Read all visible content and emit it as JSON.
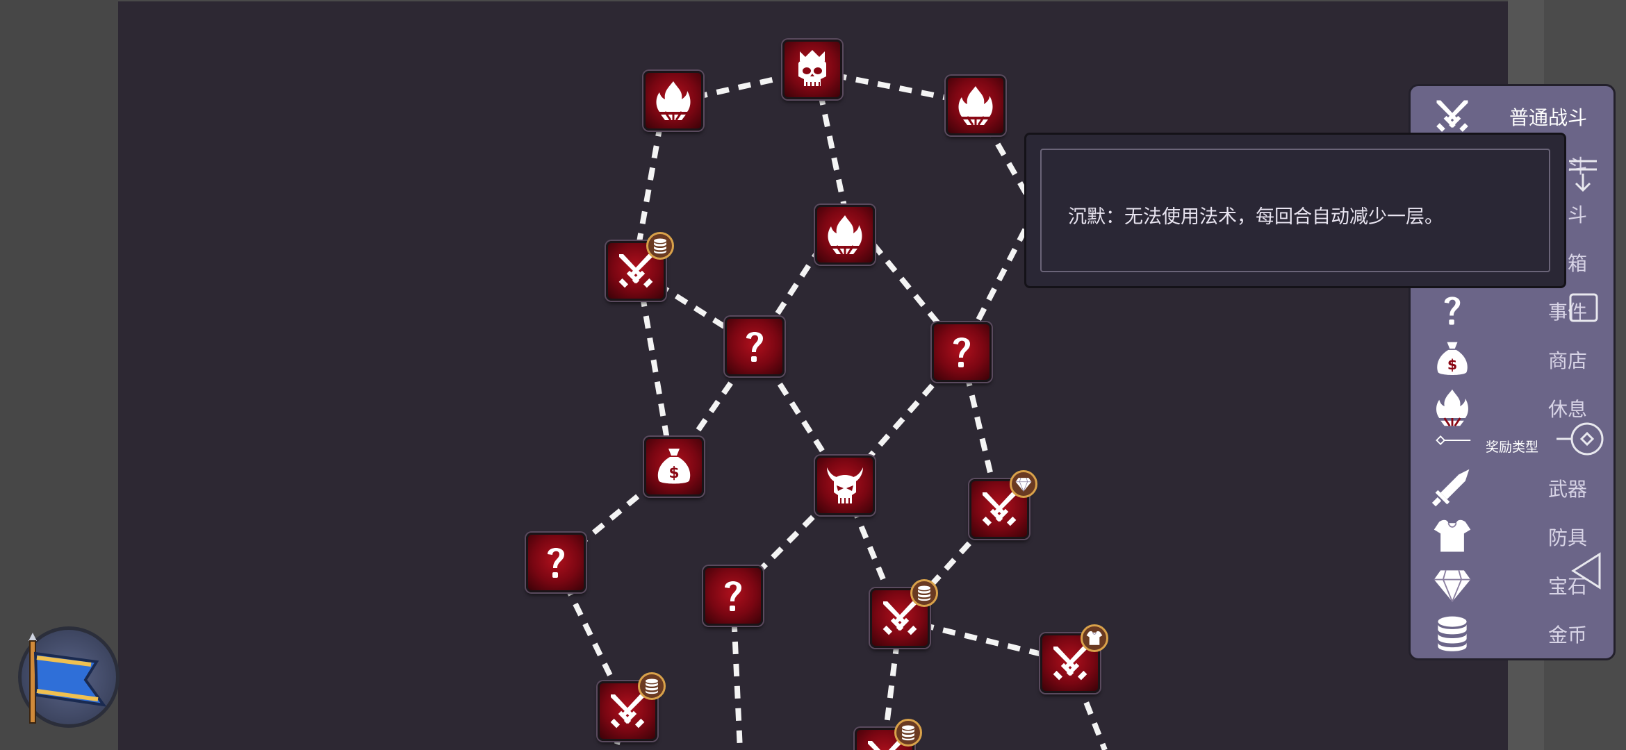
{
  "tooltip": {
    "text": "沉默：无法使用法术，每回合自动减少一层。"
  },
  "legend": {
    "items": [
      {
        "label": "普通战斗",
        "icon": "crossed-swords-icon"
      },
      {
        "label": "斗",
        "icon": "hidden"
      },
      {
        "label": "斗",
        "icon": "hidden"
      },
      {
        "label": "箱",
        "icon": "hidden"
      },
      {
        "label": "事件",
        "icon": "question-icon"
      },
      {
        "label": "商店",
        "icon": "money-bag-icon"
      },
      {
        "label": "休息",
        "icon": "campfire-icon"
      },
      {
        "label": "奖励类型",
        "icon": "divider-icon"
      },
      {
        "label": "武器",
        "icon": "sword-icon"
      },
      {
        "label": "防具",
        "icon": "armor-icon"
      },
      {
        "label": "宝石",
        "icon": "gem-icon"
      },
      {
        "label": "金币",
        "icon": "coins-icon"
      }
    ]
  },
  "map": {
    "nodes": [
      {
        "type": "elite-boss",
        "icon": "crowned-skull-icon"
      },
      {
        "type": "rest",
        "icon": "campfire-icon"
      },
      {
        "type": "rest",
        "icon": "campfire-icon"
      },
      {
        "type": "rest",
        "icon": "campfire-icon"
      },
      {
        "type": "battle",
        "icon": "crossed-swords-icon",
        "reward": "coins-icon"
      },
      {
        "type": "event",
        "icon": "question-icon"
      },
      {
        "type": "event",
        "icon": "question-icon"
      },
      {
        "type": "shop",
        "icon": "money-bag-icon"
      },
      {
        "type": "elite",
        "icon": "horned-skull-icon"
      },
      {
        "type": "battle",
        "icon": "crossed-swords-icon",
        "reward": "gem-icon"
      },
      {
        "type": "event",
        "icon": "question-icon"
      },
      {
        "type": "event",
        "icon": "question-icon"
      },
      {
        "type": "battle",
        "icon": "crossed-swords-icon",
        "reward": "coins-icon"
      },
      {
        "type": "battle",
        "icon": "crossed-swords-icon",
        "reward": "armor-icon"
      },
      {
        "type": "battle",
        "icon": "crossed-swords-icon",
        "reward": "coins-icon"
      },
      {
        "type": "battle",
        "icon": "crossed-swords-icon",
        "reward": "coins-icon"
      }
    ]
  },
  "colors": {
    "background": "#2d2833",
    "node_red": "#9a0a18",
    "legend_panel": "#6b6588",
    "badge_ring": "#d9a24a"
  }
}
